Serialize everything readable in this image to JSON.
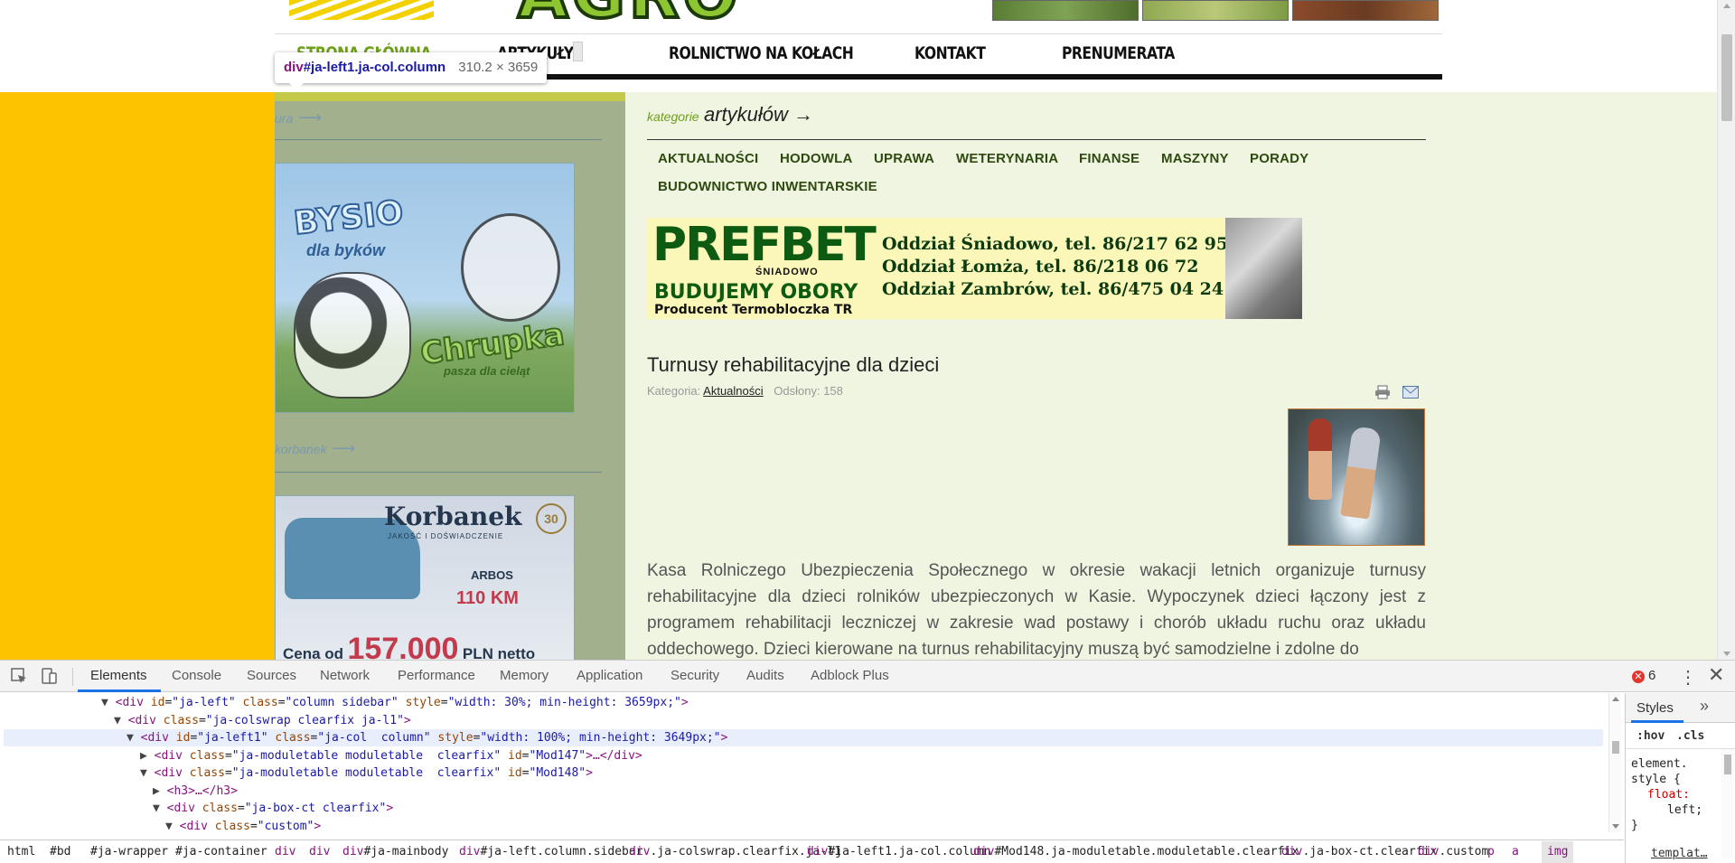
{
  "site": {
    "nav": {
      "home": "Strona główna",
      "articles": "Artykuły",
      "wheels": "Rolnictwo na kołach",
      "contact": "Kontakt",
      "subscription": "Prenumerata"
    },
    "inspect_tooltip": {
      "tag": "div",
      "selector": "#ja-left1.ja-col.column",
      "dims": "310.2 × 3659"
    },
    "sidebar": {
      "heading1": "ura",
      "heading2": "korbanek",
      "arrow": "⟶",
      "ad_bysio": {
        "brand": "BYSIO",
        "sub": "dla byków",
        "product": "Chrupka",
        "product_sub": "pasza dla cieląt"
      },
      "ad_korbanek": {
        "brand": "Korbanek",
        "badge": "30",
        "tagline": "JAKOŚĆ I DOŚWIADCZENIE",
        "model": "ARBOS",
        "power": "110 KM",
        "price_prefix": "Cena od",
        "price": "157.000",
        "price_suffix": "PLN netto"
      }
    },
    "categories": {
      "label": "kategorie",
      "title": "artykułów →",
      "items": [
        "Aktualności",
        "Hodowla",
        "Uprawa",
        "Weterynaria",
        "Finanse",
        "Maszyny",
        "Porady",
        "Budownictwo inwentarskie"
      ]
    },
    "banner": {
      "logo": "PREFBET",
      "logo_sub": "ŚNIADOWO",
      "slogan": "BUDUJEMY OBORY",
      "producer": "Producent Termobloczka TR",
      "branches": [
        "Oddział Śniadowo, tel. 86/217 62 95",
        "Oddział Łomża, tel. 86/218 06 72",
        "Oddział Zambrów, tel. 86/475 04 24"
      ]
    },
    "article": {
      "title": "Turnusy rehabilitacyjne dla dzieci",
      "category_label": "Kategoria:",
      "category": "Aktualności",
      "views": "Odsłony: 158",
      "body": "Kasa Rolniczego Ubezpieczenia Społecznego w okresie wakacji letnich organizuje turnusy rehabilitacyjne dla dzieci rolników ubezpieczonych w Kasie. Wypoczynek dzieci łączony jest  z programem rehabilitacji leczniczej w zakresie wad postawy i chorób układu ruchu oraz układu oddechowego. Dzieci kierowane na turnus rehabilitacyjny muszą być samodzielne i zdolne do"
    }
  },
  "devtools": {
    "tabs": [
      "Elements",
      "Console",
      "Sources",
      "Network",
      "Performance",
      "Memory",
      "Application",
      "Security",
      "Audits",
      "Adblock Plus"
    ],
    "active_tab": "Elements",
    "error_count": "6",
    "dom_lines": [
      {
        "tri": "▼",
        "tag": "div",
        "attrs": [
          [
            "id",
            "ja-left"
          ],
          [
            "class",
            "column sidebar"
          ],
          [
            "style",
            "width: 30%; min-height: 3659px;"
          ]
        ],
        "tail": ">"
      },
      {
        "tri": "▼",
        "tag": "div",
        "attrs": [
          [
            "class",
            "ja-colswrap clearfix ja-l1"
          ]
        ],
        "tail": ">"
      },
      {
        "tri": "▼",
        "tag": "div",
        "attrs": [
          [
            "id",
            "ja-left1"
          ],
          [
            "class",
            "ja-col  column"
          ],
          [
            "style",
            "width: 100%; min-height: 3649px;"
          ]
        ],
        "tail": ">"
      },
      {
        "tri": "▶",
        "tag": "div",
        "attrs": [
          [
            "class",
            "ja-moduletable moduletable  clearfix"
          ],
          [
            "id",
            "Mod147"
          ]
        ],
        "tail": ">…</div>"
      },
      {
        "tri": "▼",
        "tag": "div",
        "attrs": [
          [
            "class",
            "ja-moduletable moduletable  clearfix"
          ],
          [
            "id",
            "Mod148"
          ]
        ],
        "tail": ">"
      },
      {
        "tri": "▶",
        "tag": "h3",
        "attrs": [],
        "tail": ">…</h3>"
      },
      {
        "tri": "▼",
        "tag": "div",
        "attrs": [
          [
            "class",
            "ja-box-ct clearfix"
          ]
        ],
        "tail": ">"
      },
      {
        "tri": "▼",
        "tag": "div",
        "attrs": [
          [
            "class",
            "custom"
          ]
        ],
        "tail": ">"
      }
    ],
    "styles": {
      "tab": "Styles",
      "more": "»",
      "hov": ":hov",
      "cls": ".cls",
      "rule_selector": "element.",
      "rule_open": "style {",
      "prop": "float:",
      "value": "left;",
      "rule_close": "}",
      "source": "templat…"
    },
    "breadcrumbs": [
      [
        "html",
        ""
      ],
      [
        "#bd",
        ""
      ],
      [
        "#ja-wrapper",
        ""
      ],
      [
        "#ja-container",
        ""
      ],
      [
        "div",
        ""
      ],
      [
        "div",
        ""
      ],
      [
        "div",
        "#ja-mainbody"
      ],
      [
        "div",
        "#ja-left.column.sidebar"
      ],
      [
        "div",
        ".ja-colswrap.clearfix.ja-l1"
      ],
      [
        "div",
        "#ja-left1.ja-col.column"
      ],
      [
        "div",
        "#Mod148.ja-moduletable.moduletable.clearfix"
      ],
      [
        "div",
        ".ja-box-ct.clearfix"
      ],
      [
        "div",
        ".custom"
      ],
      [
        "p",
        ""
      ],
      [
        "a",
        ""
      ],
      [
        "img",
        ""
      ]
    ]
  }
}
